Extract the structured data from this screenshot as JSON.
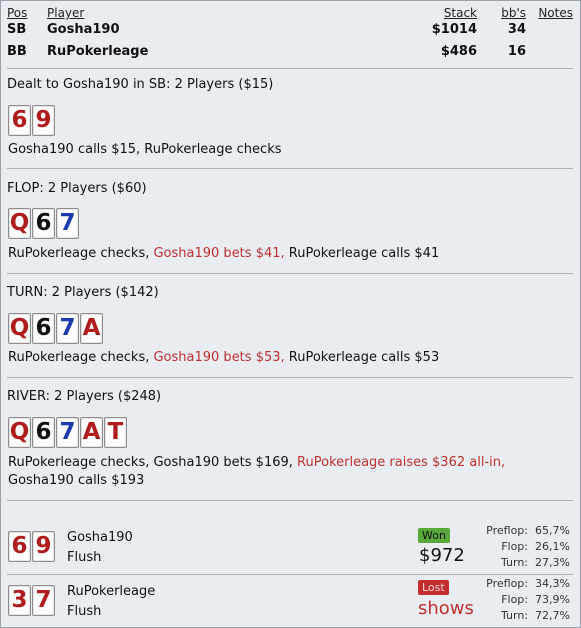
{
  "header": {
    "col_pos": "Pos",
    "col_player": "Player",
    "col_stack": "Stack",
    "col_bb": "bb's",
    "col_notes": "Notes",
    "players": [
      {
        "pos": "SB",
        "name": "Gosha190",
        "stack": "$1014",
        "bb": "34"
      },
      {
        "pos": "BB",
        "name": "RuPokerleage",
        "stack": "$486",
        "bb": "16"
      }
    ]
  },
  "preflop": {
    "title": "Dealt to Gosha190 in SB: 2 Players ($15)",
    "cards": [
      {
        "rank": "6",
        "color": "red"
      },
      {
        "rank": "9",
        "color": "red"
      }
    ],
    "action": "Gosha190 calls $15, RuPokerleage checks"
  },
  "flop": {
    "title": "FLOP: 2 Players ($60)",
    "cards": [
      {
        "rank": "Q",
        "color": "red"
      },
      {
        "rank": "6",
        "color": "black"
      },
      {
        "rank": "7",
        "color": "blue"
      }
    ],
    "action_a": "RuPokerleage checks, ",
    "action_b": "Gosha190 bets $41,",
    "action_c": " RuPokerleage calls $41"
  },
  "turn": {
    "title": "TURN: 2 Players ($142)",
    "cards": [
      {
        "rank": "Q",
        "color": "red"
      },
      {
        "rank": "6",
        "color": "black"
      },
      {
        "rank": "7",
        "color": "blue"
      },
      {
        "rank": "A",
        "color": "red"
      }
    ],
    "action_a": "RuPokerleage checks, ",
    "action_b": "Gosha190 bets $53,",
    "action_c": " RuPokerleage calls $53"
  },
  "river": {
    "title": "RIVER: 2 Players ($248)",
    "cards": [
      {
        "rank": "Q",
        "color": "red"
      },
      {
        "rank": "6",
        "color": "black"
      },
      {
        "rank": "7",
        "color": "blue"
      },
      {
        "rank": "A",
        "color": "red"
      },
      {
        "rank": "T",
        "color": "red"
      }
    ],
    "action_a": "RuPokerleage checks, Gosha190 bets $169, ",
    "action_b": "RuPokerleage raises $362 all-in,",
    "action_c": " Gosha190 calls $193"
  },
  "results": [
    {
      "name": "Gosha190",
      "hand": "Flush",
      "cards": [
        {
          "rank": "6",
          "color": "red"
        },
        {
          "rank": "9",
          "color": "red"
        }
      ],
      "badge": "Won",
      "amount": "$972",
      "stats": [
        {
          "label": "Preflop:",
          "value": "65,7%"
        },
        {
          "label": "Flop:",
          "value": "26,1%"
        },
        {
          "label": "Turn:",
          "value": "27,3%"
        }
      ]
    },
    {
      "name": "RuPokerleage",
      "hand": "Flush",
      "cards": [
        {
          "rank": "3",
          "color": "red"
        },
        {
          "rank": "7",
          "color": "red"
        }
      ],
      "badge": "Lost",
      "amount": "shows",
      "stats": [
        {
          "label": "Preflop:",
          "value": "34,3%"
        },
        {
          "label": "Flop:",
          "value": "73,9%"
        },
        {
          "label": "Turn:",
          "value": "72,7%"
        }
      ]
    }
  ],
  "colors": {
    "red_card": "#b01c1c",
    "black_card": "#111111",
    "blue_card": "#1a3bb0",
    "action_red": "#c0302f",
    "won_badge": "#58a83a",
    "lost_badge": "#c22d2d"
  }
}
